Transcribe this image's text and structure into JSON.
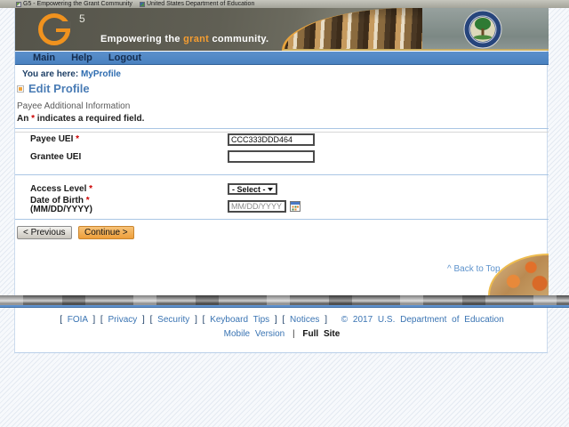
{
  "browser_tabs": {
    "tab1": "G5 - Empowering the Grant Community",
    "tab2": "United States Department of Education"
  },
  "banner": {
    "logo_number": "5",
    "tagline_pre": "Empowering the ",
    "tagline_highlight": "grant",
    "tagline_post": " community."
  },
  "nav": {
    "items": [
      "Main",
      "Help",
      "Logout"
    ]
  },
  "breadcrumb": {
    "prefix": "You are here: ",
    "link": "MyProfile"
  },
  "page": {
    "title": "Edit Profile"
  },
  "form": {
    "section_title": "Payee Additional Information",
    "required_note": {
      "pre": "An ",
      "star": "*",
      "post": " indicates a required field."
    },
    "payee_uei": {
      "label": "Payee UEI ",
      "star": "*",
      "value": "CCC333DDD464"
    },
    "grantee_uei": {
      "label": "Grantee UEI",
      "value": ""
    },
    "access_level": {
      "label": "Access Level ",
      "star": "*",
      "selected": "- Select -"
    },
    "dob": {
      "label": "Date of Birth ",
      "star": "*",
      "format": "(MM/DD/YYYY)",
      "placeholder": "MM/DD/YYYY"
    },
    "previous_button": "< Previous",
    "continue_button": "Continue >"
  },
  "back_to_top": "^ Back to Top",
  "footer": {
    "bracket_l": "[",
    "bracket_r": "]",
    "links": [
      "FOIA",
      "Privacy",
      "Security",
      "Keyboard Tips",
      "Notices"
    ],
    "copyright": "© 2017 U.S. Department of Education",
    "mobile": "Mobile Version",
    "divider": "|",
    "full_site": "Full Site"
  },
  "colors": {
    "accent_orange": "#f59d31",
    "nav_blue": "#4e86c4",
    "link_blue": "#3a74b3",
    "required_red": "#cc0000",
    "continue_button": "#ee9f3b"
  }
}
